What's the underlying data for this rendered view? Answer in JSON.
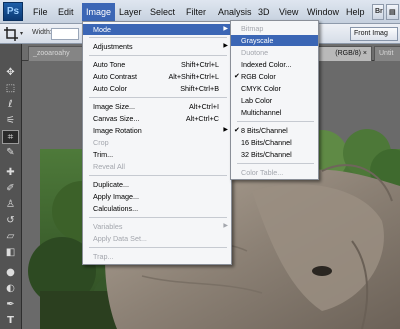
{
  "menubar": {
    "app_logo": "Ps",
    "items": [
      "File",
      "Edit",
      "Image",
      "Layer",
      "Select",
      "Filter",
      "Analysis",
      "3D",
      "View",
      "Window",
      "Help"
    ],
    "active_index": 2
  },
  "options_bar": {
    "width_label": "Width:",
    "front_image_button": "Front Imag"
  },
  "tabs": [
    {
      "label": "_zooaroahy",
      "active": false
    },
    {
      "label": "(RGB/8) ×",
      "active": true
    },
    {
      "label": "Untit",
      "active": false
    }
  ],
  "image_menu": {
    "items": [
      {
        "label": "Mode",
        "shortcut": "",
        "submenu": true,
        "disabled": false,
        "highlighted": true
      },
      {
        "label": "Adjustments",
        "shortcut": "",
        "submenu": true,
        "disabled": false
      },
      {
        "label": "Auto Tone",
        "shortcut": "Shift+Ctrl+L",
        "disabled": false
      },
      {
        "label": "Auto Contrast",
        "shortcut": "Alt+Shift+Ctrl+L",
        "disabled": false
      },
      {
        "label": "Auto Color",
        "shortcut": "Shift+Ctrl+B",
        "disabled": false
      },
      {
        "label": "Image Size...",
        "shortcut": "Alt+Ctrl+I",
        "disabled": false
      },
      {
        "label": "Canvas Size...",
        "shortcut": "Alt+Ctrl+C",
        "disabled": false
      },
      {
        "label": "Image Rotation",
        "shortcut": "",
        "submenu": true,
        "disabled": false
      },
      {
        "label": "Crop",
        "shortcut": "",
        "disabled": true
      },
      {
        "label": "Trim...",
        "shortcut": "",
        "disabled": false
      },
      {
        "label": "Reveal All",
        "shortcut": "",
        "disabled": true
      },
      {
        "label": "Duplicate...",
        "shortcut": "",
        "disabled": false
      },
      {
        "label": "Apply Image...",
        "shortcut": "",
        "disabled": false
      },
      {
        "label": "Calculations...",
        "shortcut": "",
        "disabled": false
      },
      {
        "label": "Variables",
        "shortcut": "",
        "submenu": true,
        "disabled": true
      },
      {
        "label": "Apply Data Set...",
        "shortcut": "",
        "disabled": true
      },
      {
        "label": "Trap...",
        "shortcut": "",
        "disabled": true
      }
    ]
  },
  "mode_submenu": {
    "items": [
      {
        "label": "Bitmap",
        "disabled": true,
        "checked": false
      },
      {
        "label": "Grayscale",
        "disabled": false,
        "checked": false,
        "highlighted": true
      },
      {
        "label": "Duotone",
        "disabled": true,
        "checked": false
      },
      {
        "label": "Indexed Color...",
        "disabled": false,
        "checked": false
      },
      {
        "label": "RGB Color",
        "disabled": false,
        "checked": true
      },
      {
        "label": "CMYK Color",
        "disabled": false,
        "checked": false
      },
      {
        "label": "Lab Color",
        "disabled": false,
        "checked": false
      },
      {
        "label": "Multichannel",
        "disabled": false,
        "checked": false
      },
      {
        "label": "8 Bits/Channel",
        "disabled": false,
        "checked": true
      },
      {
        "label": "16 Bits/Channel",
        "disabled": false,
        "checked": false
      },
      {
        "label": "32 Bits/Channel",
        "disabled": false,
        "checked": false
      },
      {
        "label": "Color Table...",
        "disabled": true,
        "checked": false
      }
    ]
  },
  "colors": {
    "menu_highlight": "#3b66b5",
    "disabled_text": "#a3a6ad"
  },
  "icons": {
    "tools": [
      "move-tool-icon",
      "marquee-tool-icon",
      "lasso-tool-icon",
      "magic-wand-tool-icon",
      "crop-tool-icon",
      "eyedropper-tool-icon",
      "healing-brush-tool-icon",
      "brush-tool-icon",
      "clone-stamp-tool-icon",
      "history-brush-tool-icon",
      "eraser-tool-icon",
      "paint-bucket-tool-icon",
      "blur-tool-icon",
      "dodge-tool-icon",
      "pen-tool-icon",
      "type-tool-icon"
    ]
  }
}
